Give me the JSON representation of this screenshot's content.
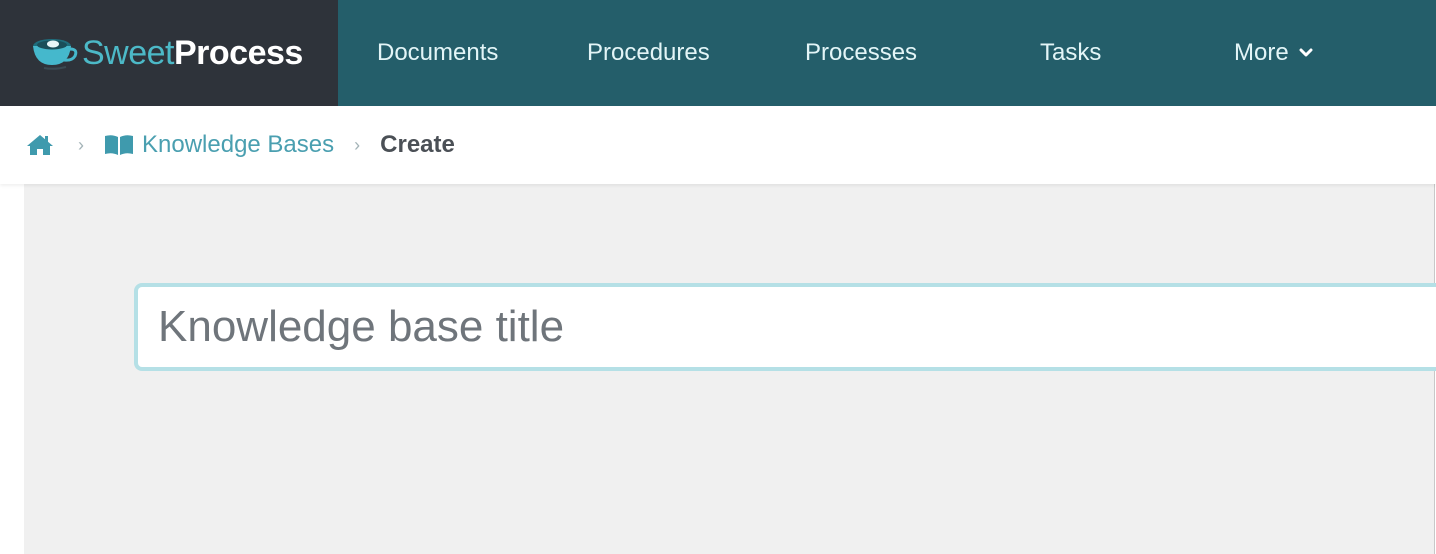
{
  "app": {
    "brand_first": "Sweet",
    "brand_second": "Process",
    "brand_color": "#4cb9c7",
    "logo_icon": "coffee-cup-icon"
  },
  "nav": {
    "items": [
      {
        "label": "Documents"
      },
      {
        "label": "Procedures"
      },
      {
        "label": "Processes"
      },
      {
        "label": "Tasks"
      },
      {
        "label": "More",
        "icon": "chevron-down-icon"
      }
    ],
    "background": "#245e6a"
  },
  "breadcrumb": {
    "home_icon": "home-icon",
    "items": [
      {
        "label": "Knowledge Bases",
        "icon": "book-icon"
      },
      {
        "label": "Create"
      }
    ]
  },
  "form": {
    "title_placeholder": "Knowledge base title",
    "title_value": ""
  }
}
